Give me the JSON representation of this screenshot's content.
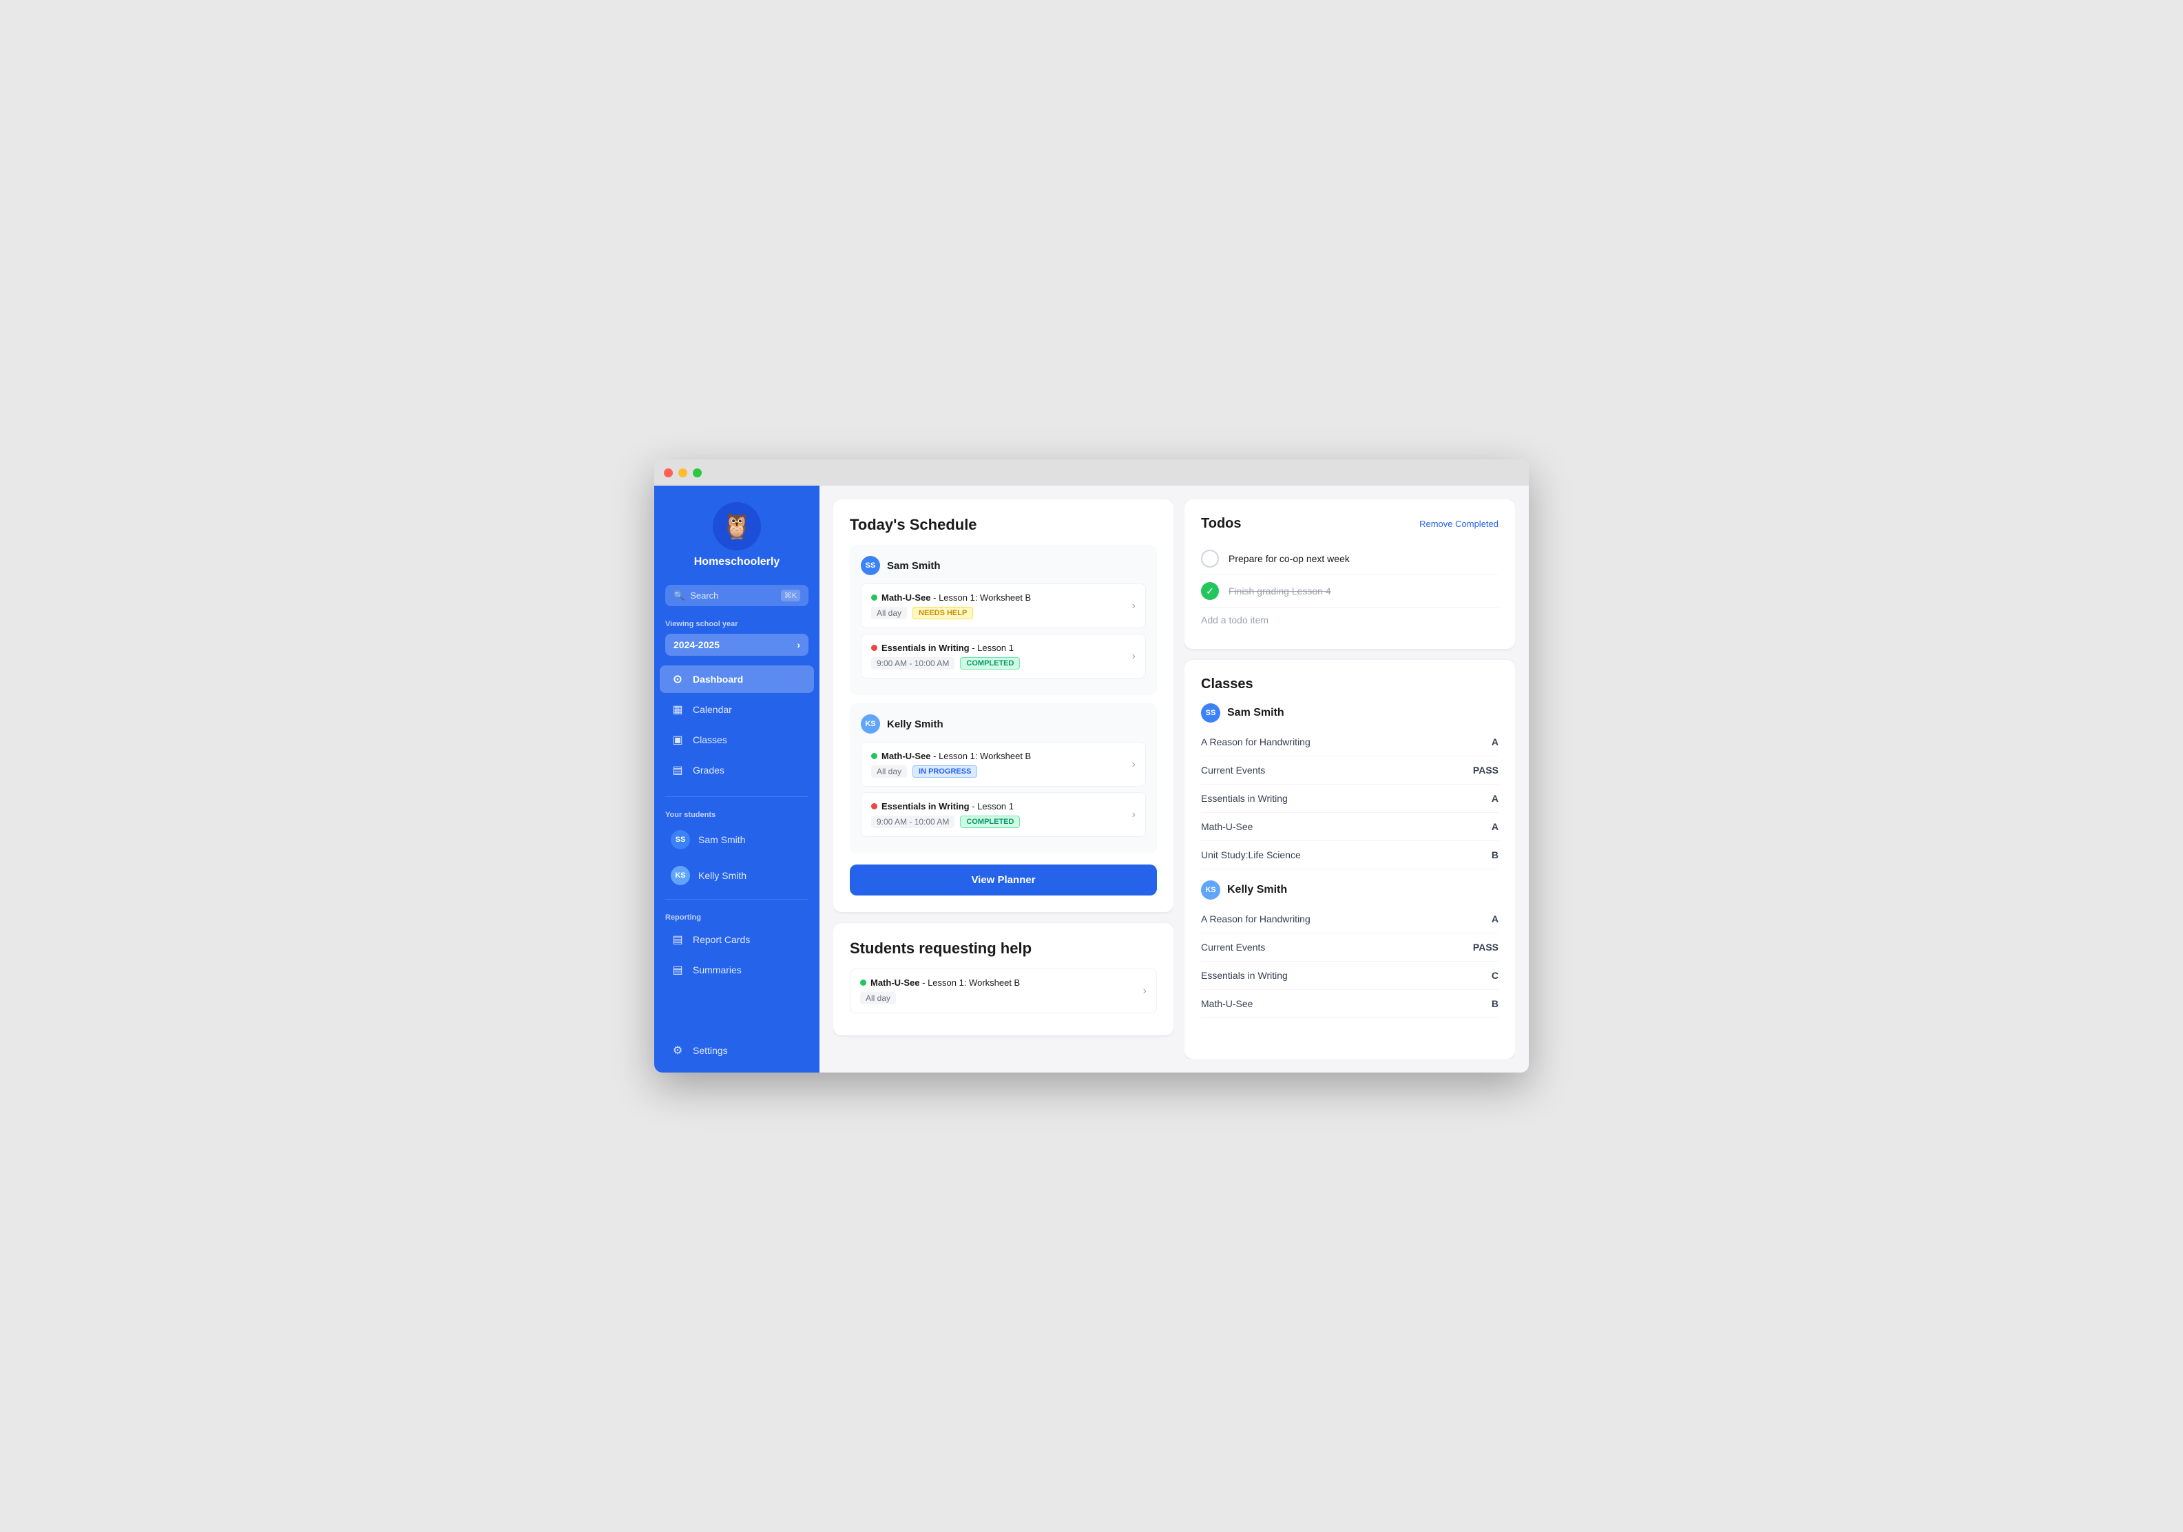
{
  "app": {
    "name": "Homeschoolerly",
    "logo_emoji": "🦉"
  },
  "titlebar": {
    "buttons": [
      "close",
      "minimize",
      "maximize"
    ]
  },
  "sidebar": {
    "search_placeholder": "Search",
    "search_shortcut": "⌘K",
    "school_year_label": "Viewing school year",
    "school_year": "2024-2025",
    "nav_items": [
      {
        "id": "dashboard",
        "label": "Dashboard",
        "icon": "⊙",
        "active": true
      },
      {
        "id": "calendar",
        "label": "Calendar",
        "icon": "▦"
      },
      {
        "id": "classes",
        "label": "Classes",
        "icon": "▣"
      },
      {
        "id": "grades",
        "label": "Grades",
        "icon": "▤"
      }
    ],
    "students_label": "Your students",
    "students": [
      {
        "id": "sam-smith",
        "label": "Sam Smith",
        "initials": "SS",
        "color": "avatar-ss"
      },
      {
        "id": "kelly-smith",
        "label": "Kelly Smith",
        "initials": "KS",
        "color": "avatar-ks"
      }
    ],
    "reporting_label": "Reporting",
    "reporting_items": [
      {
        "id": "report-cards",
        "label": "Report Cards",
        "icon": "▤"
      },
      {
        "id": "summaries",
        "label": "Summaries",
        "icon": "▤"
      }
    ],
    "settings_label": "Settings",
    "settings_icon": "⚙"
  },
  "schedule": {
    "title": "Today's Schedule",
    "students": [
      {
        "name": "Sam Smith",
        "initials": "SS",
        "color": "avatar-ss",
        "lessons": [
          {
            "subject": "Math-U-See",
            "detail": "Lesson 1: Worksheet B",
            "time": "All day",
            "badge": "NEEDS HELP",
            "badge_class": "badge-needs-help",
            "dot": "dot-green"
          },
          {
            "subject": "Essentials in Writing",
            "detail": "Lesson 1",
            "time": "9:00 AM - 10:00 AM",
            "badge": "COMPLETED",
            "badge_class": "badge-completed",
            "dot": "dot-red"
          }
        ]
      },
      {
        "name": "Kelly Smith",
        "initials": "KS",
        "color": "avatar-ks",
        "lessons": [
          {
            "subject": "Math-U-See",
            "detail": "Lesson 1: Worksheet B",
            "time": "All day",
            "badge": "IN PROGRESS",
            "badge_class": "badge-in-progress",
            "dot": "dot-green"
          },
          {
            "subject": "Essentials in Writing",
            "detail": "Lesson 1",
            "time": "9:00 AM - 10:00 AM",
            "badge": "COMPLETED",
            "badge_class": "badge-completed",
            "dot": "dot-red"
          }
        ]
      }
    ],
    "view_planner_label": "View Planner"
  },
  "students_help": {
    "title": "Students requesting help",
    "lessons": [
      {
        "subject": "Math-U-See",
        "detail": "Lesson 1: Worksheet B",
        "time": "All day",
        "dot": "dot-green"
      }
    ]
  },
  "todos": {
    "title": "Todos",
    "remove_completed_label": "Remove Completed",
    "items": [
      {
        "id": "todo-1",
        "text": "Prepare for co-op next week",
        "completed": false
      },
      {
        "id": "todo-2",
        "text": "Finish grading Lesson 4",
        "completed": true
      }
    ],
    "add_placeholder": "Add a todo item"
  },
  "classes": {
    "title": "Classes",
    "students": [
      {
        "name": "Sam Smith",
        "initials": "SS",
        "color": "avatar-ss",
        "classes": [
          {
            "name": "A Reason for Handwriting",
            "grade": "A"
          },
          {
            "name": "Current Events",
            "grade": "PASS"
          },
          {
            "name": "Essentials in Writing",
            "grade": "A"
          },
          {
            "name": "Math-U-See",
            "grade": "A"
          },
          {
            "name": "Unit Study:Life Science",
            "grade": "B"
          }
        ]
      },
      {
        "name": "Kelly Smith",
        "initials": "KS",
        "color": "avatar-ks",
        "classes": [
          {
            "name": "A Reason for Handwriting",
            "grade": "A"
          },
          {
            "name": "Current Events",
            "grade": "PASS"
          },
          {
            "name": "Essentials in Writing",
            "grade": "C"
          },
          {
            "name": "Math-U-See",
            "grade": "B"
          }
        ]
      }
    ]
  }
}
